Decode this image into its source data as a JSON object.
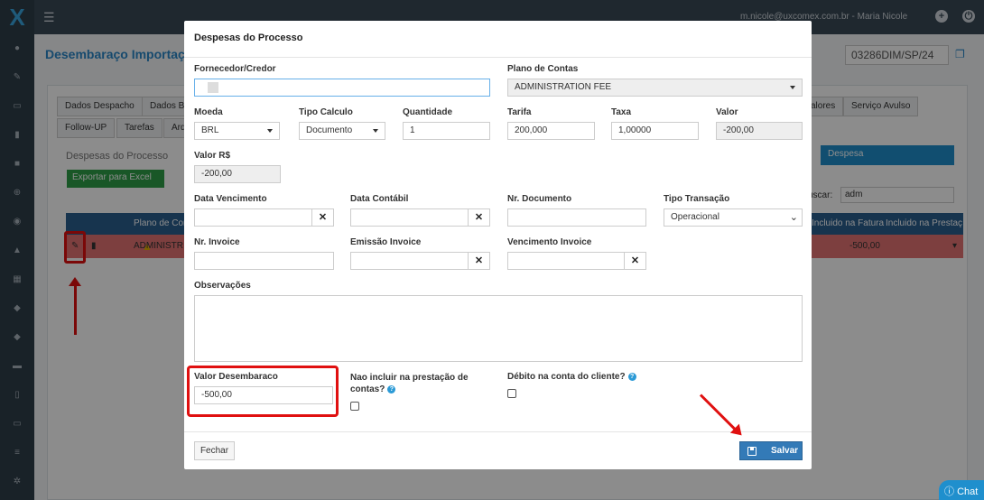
{
  "topbar": {
    "user": "m.nicole@uxcomex.com.br - Maria Nicole"
  },
  "page": {
    "title": "Desembaraço Importação",
    "process_number": "03286DIM/SP/24"
  },
  "tabs_row1": [
    "Dados Despacho",
    "Dados Bá",
    "alores",
    "Serviço Avulso"
  ],
  "tabs_row2": [
    "Follow-UP",
    "Tarefas",
    "Arq"
  ],
  "section": {
    "title": "Despesas do Processo",
    "export_label": "Exportar para Excel",
    "add_label": "Despesa",
    "search_label": "uscar:",
    "search_value": "adm"
  },
  "table": {
    "headers": [
      "Plano de Con",
      "Incluido na Fatura",
      "Incluido na Prestaç"
    ],
    "row": {
      "plano": "ADMINISTR",
      "fatura_valor": "-500,00"
    }
  },
  "modal": {
    "title": "Despesas do Processo",
    "labels": {
      "fornecedor": "Fornecedor/Credor",
      "plano": "Plano de Contas",
      "moeda": "Moeda",
      "tipo_calculo": "Tipo Calculo",
      "quantidade": "Quantidade",
      "tarifa": "Tarifa",
      "taxa": "Taxa",
      "valor": "Valor",
      "valor_rs": "Valor R$",
      "data_vencimento": "Data Vencimento",
      "data_contabil": "Data Contábil",
      "nr_documento": "Nr. Documento",
      "tipo_transacao": "Tipo Transação",
      "nr_invoice": "Nr. Invoice",
      "emissao_invoice": "Emissão Invoice",
      "vencimento_invoice": "Vencimento Invoice",
      "observacoes": "Observações",
      "valor_desembaraco": "Valor Desembaraco",
      "nao_incluir_1": "Nao incluir na prestação de",
      "nao_incluir_2": "contas?",
      "debito_conta": "Débito na conta do cliente?"
    },
    "values": {
      "plano": "ADMINISTRATION FEE",
      "moeda": "BRL",
      "tipo_calculo": "Documento",
      "quantidade": "1",
      "tarifa": "200,000",
      "taxa": "1,00000",
      "valor": "-200,00",
      "valor_rs": "-200,00",
      "tipo_transacao": "Operacional",
      "valor_desembaraco": "-500,00"
    },
    "buttons": {
      "close": "Fechar",
      "save": "Salvar"
    }
  },
  "chat": {
    "label": "Chat"
  }
}
